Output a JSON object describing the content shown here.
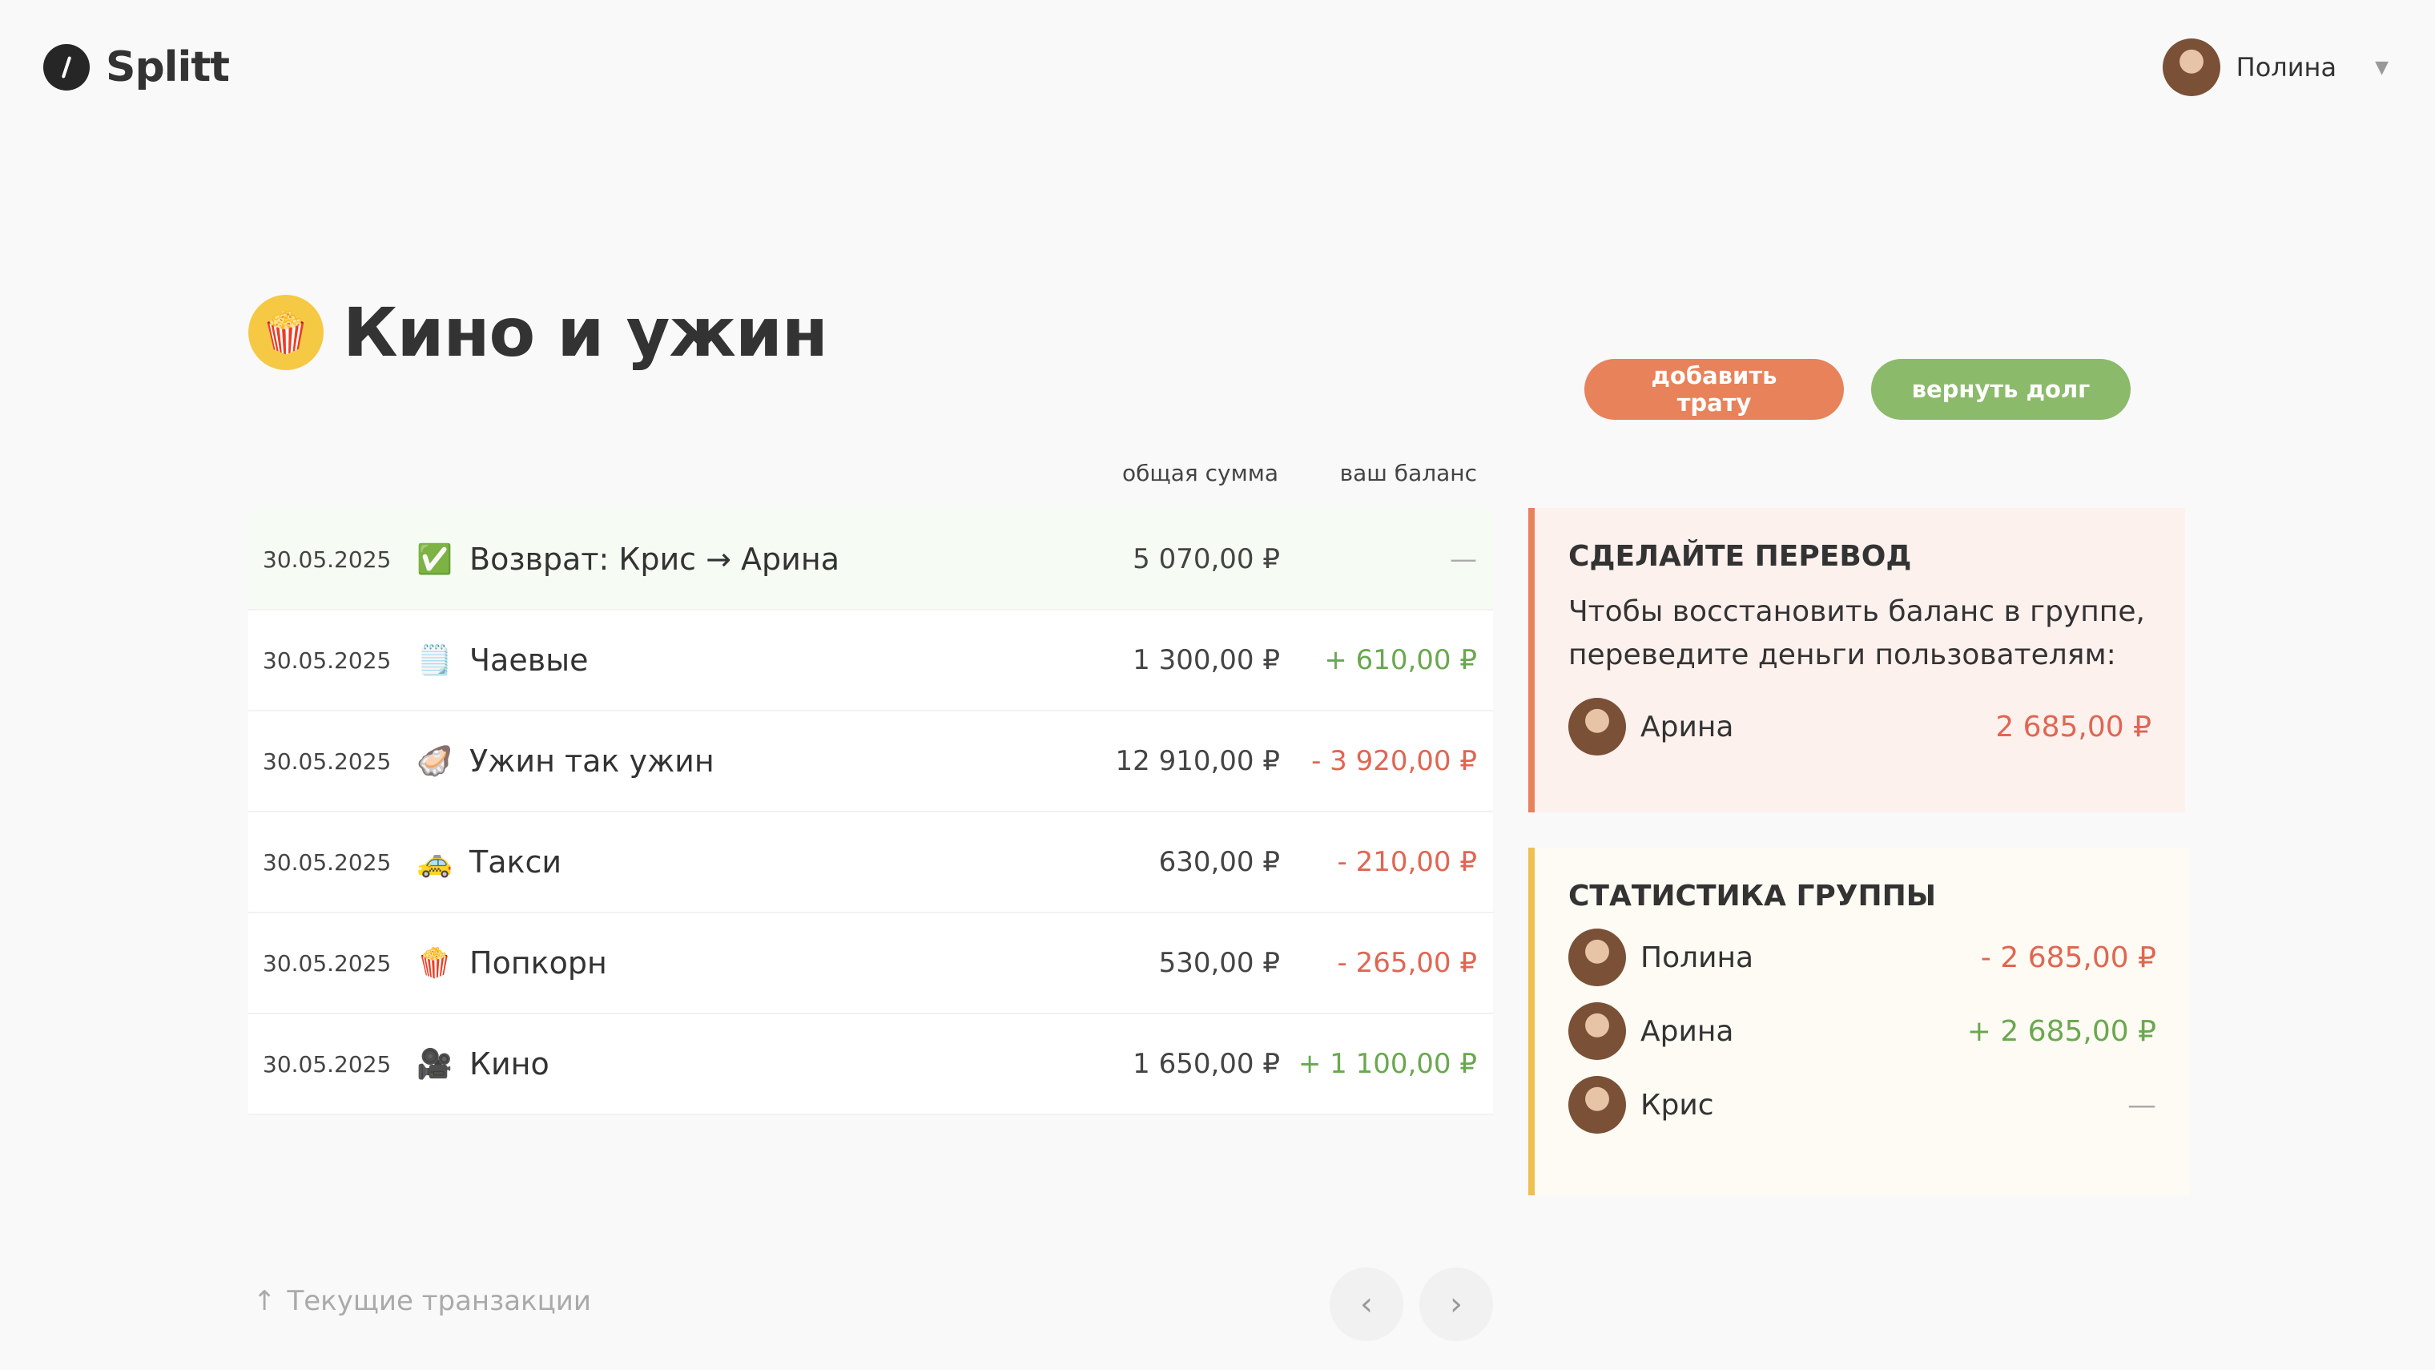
{
  "app": {
    "name": "Splitt"
  },
  "user": {
    "name": "Полина",
    "caret": "▼"
  },
  "group": {
    "emoji": "🍿",
    "title": "Кино и ужин"
  },
  "actions": {
    "add_expense": "добавить трату",
    "repay_debt": "вернуть долг"
  },
  "table": {
    "columns": {
      "total": "общая сумма",
      "balance": "ваш баланс"
    },
    "rows": [
      {
        "date": "30.05.2025",
        "icon": "✅",
        "name": "Возврат: Крис → Арина",
        "total": "5 070,00 ₽",
        "balance": "—",
        "balance_type": "zero"
      },
      {
        "date": "30.05.2025",
        "icon": "🗒️",
        "name": "Чаевые",
        "total": "1 300,00 ₽",
        "balance": "+ 610,00 ₽",
        "balance_type": "pos"
      },
      {
        "date": "30.05.2025",
        "icon": "🦪",
        "name": "Ужин так ужин",
        "total": "12 910,00 ₽",
        "balance": "- 3 920,00 ₽",
        "balance_type": "neg"
      },
      {
        "date": "30.05.2025",
        "icon": "🚕",
        "name": "Такси",
        "total": "630,00 ₽",
        "balance": "- 210,00 ₽",
        "balance_type": "neg"
      },
      {
        "date": "30.05.2025",
        "icon": "🍿",
        "name": "Попкорн",
        "total": "530,00 ₽",
        "balance": "- 265,00 ₽",
        "balance_type": "neg"
      },
      {
        "date": "30.05.2025",
        "icon": "🎥",
        "name": "Кино",
        "total": "1 650,00 ₽",
        "balance": "+ 1 100,00 ₽",
        "balance_type": "pos"
      }
    ]
  },
  "transfer_card": {
    "title": "СДЕЛАЙТЕ ПЕРЕВОД",
    "description": "Чтобы восстановить баланс в группе, переведите деньги пользователям:",
    "recipients": [
      {
        "name": "Арина",
        "amount": "2 685,00 ₽",
        "amount_type": "neg"
      }
    ]
  },
  "stats_card": {
    "title": "СТАТИСТИКА ГРУППЫ",
    "members": [
      {
        "name": "Полина",
        "amount": "- 2 685,00 ₽",
        "amount_type": "neg"
      },
      {
        "name": "Арина",
        "amount": "+ 2 685,00 ₽",
        "amount_type": "pos"
      },
      {
        "name": "Крис",
        "amount": "—",
        "amount_type": "zero"
      }
    ]
  },
  "footer": {
    "current_transactions": "Текущие транзакции",
    "arrow": "↑",
    "prev": "‹",
    "next": "›"
  },
  "colors": {
    "accent_orange": "#e8825a",
    "accent_green": "#8cba6b",
    "positive": "#6aa84f",
    "negative": "#e06652",
    "stats_border": "#f0c04f"
  }
}
